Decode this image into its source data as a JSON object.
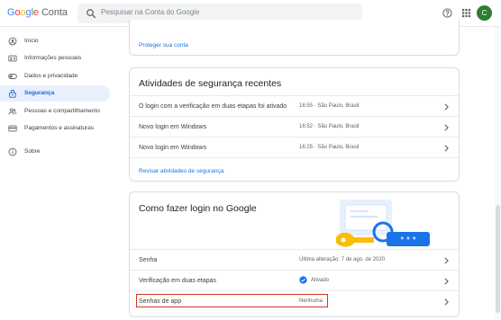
{
  "header": {
    "logo_letters": [
      "G",
      "o",
      "o",
      "g",
      "l",
      "e"
    ],
    "product": "Conta",
    "search_placeholder": "Pesquisar na Conta do Google",
    "avatar_initial": "C",
    "icons": [
      "search-icon",
      "help-icon",
      "apps-icon"
    ]
  },
  "sidebar": {
    "items": [
      {
        "label": "Início",
        "icon": "home-icon"
      },
      {
        "label": "Informações pessoais",
        "icon": "id-card-icon"
      },
      {
        "label": "Dados e privacidade",
        "icon": "toggle-icon"
      },
      {
        "label": "Segurança",
        "icon": "lock-icon",
        "active": true
      },
      {
        "label": "Pessoas e compartilhamento",
        "icon": "people-icon"
      },
      {
        "label": "Pagamentos e assinaturas",
        "icon": "credit-card-icon"
      },
      {
        "label": "Sobre",
        "icon": "info-icon"
      }
    ]
  },
  "protect_card": {
    "link": "Proteger sua conta"
  },
  "activity_card": {
    "title": "Atividades de segurança recentes",
    "rows": [
      {
        "label": "O login com a verificação em duas etapas foi ativado",
        "meta": "16:55 · São Paulo, Brasil"
      },
      {
        "label": "Novo login em Windows",
        "meta": "16:52 · São Paulo, Brasil"
      },
      {
        "label": "Novo login em Windows",
        "meta": "16:25 · São Paulo, Brasil"
      }
    ],
    "review_link": "Revisar atividades de segurança"
  },
  "signin_card": {
    "title": "Como fazer login no Google",
    "rows": [
      {
        "label": "Senha",
        "meta": "Última alteração: 7 de ago. de 2020"
      },
      {
        "label": "Verificação em duas etapas",
        "meta": "Ativado",
        "status_icon": "check-circle-icon"
      },
      {
        "label": "Senhas de app",
        "meta": "Nenhuma",
        "highlighted": true
      }
    ],
    "illustration_text": "* * *"
  },
  "colors": {
    "accent": "#1a73e8",
    "active_nav_bg": "#e8f0fe",
    "highlight_border": "#d93025",
    "avatar": "#2e7d32"
  }
}
